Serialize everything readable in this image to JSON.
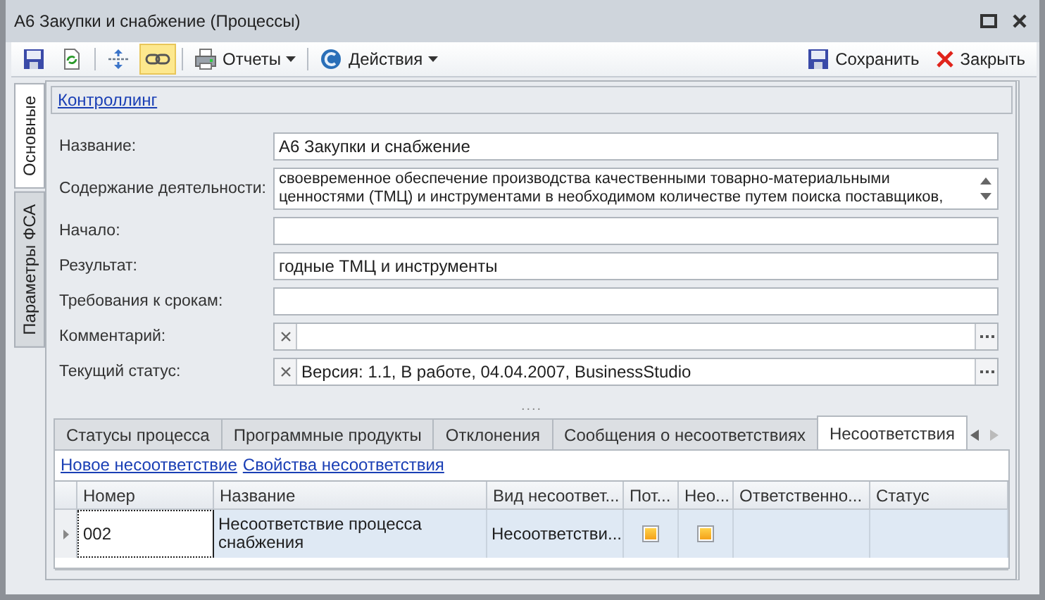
{
  "window": {
    "title": "А6 Закупки и снабжение (Процессы)"
  },
  "toolbar": {
    "items": [
      {
        "kind": "save",
        "active": false
      },
      {
        "kind": "refresh",
        "active": false
      },
      {
        "kind": "separator"
      },
      {
        "kind": "expand",
        "active": false
      },
      {
        "kind": "link",
        "active": true
      },
      {
        "kind": "separator"
      },
      {
        "kind": "print",
        "label": "Отчеты"
      },
      {
        "kind": "separator"
      },
      {
        "kind": "actions",
        "label": "Действия"
      }
    ],
    "right": [
      {
        "kind": "save",
        "label": "Сохранить"
      },
      {
        "kind": "close",
        "label": "Закрыть"
      }
    ]
  },
  "side_tabs": [
    {
      "label": "Основные",
      "selected": true
    },
    {
      "label": "Параметры ФСА",
      "selected": false
    }
  ],
  "section_link": "Контроллинг",
  "fields": [
    {
      "kind": "text",
      "label": "Название:",
      "value": "А6 Закупки и снабжение"
    },
    {
      "kind": "memo",
      "label": "Содержание деятельности:",
      "value": "своевременное обеспечение производства качественными товарно-материальными ценностями (ТМЦ) и инструментами в необходимом количестве путем поиска поставщиков,"
    },
    {
      "kind": "text",
      "label": "Начало:"
    },
    {
      "kind": "text",
      "label": "Результат:",
      "value": "годные ТМЦ и инструменты"
    },
    {
      "kind": "text",
      "label": "Требования к срокам:"
    },
    {
      "kind": "lookup",
      "label": "Комментарий:"
    },
    {
      "kind": "lookup",
      "label": "Текущий статус:",
      "value": "Версия: 1.1, В работе, 04.04.2007, BusinessStudio"
    }
  ],
  "splitter": "....",
  "tabs": [
    {
      "label": "Статусы процесса",
      "selected": false
    },
    {
      "label": "Программные продукты",
      "selected": false
    },
    {
      "label": "Отклонения",
      "selected": false
    },
    {
      "label": "Сообщения о несоответствиях",
      "selected": false
    },
    {
      "label": "Несоответствия",
      "selected": true
    }
  ],
  "actions": [
    "Новое несоответствие",
    "Свойства несоответствия"
  ],
  "table": {
    "columns": [
      "Номер",
      "Название",
      "Вид несоответ...",
      "Пот...",
      "Нео...",
      "Ответственно...",
      "Статус"
    ],
    "rows": [
      {
        "selected": true,
        "cells": [
          {
            "kind": "text",
            "text": "002"
          },
          {
            "kind": "text",
            "text": "Несоответствие процесса снабжения"
          },
          {
            "kind": "text",
            "text": "Несоответстви..."
          },
          {
            "kind": "check",
            "checked": true
          },
          {
            "kind": "check",
            "checked": true
          },
          {
            "kind": "empty"
          },
          {
            "kind": "empty"
          }
        ]
      }
    ]
  }
}
